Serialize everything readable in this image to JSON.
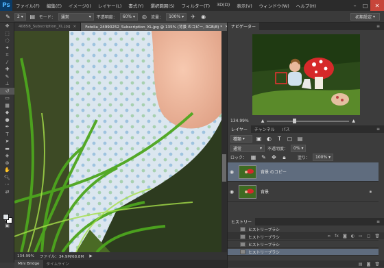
{
  "app": {
    "logo": "Ps"
  },
  "menu": [
    "ファイル(F)",
    "編集(E)",
    "イメージ(I)",
    "レイヤー(L)",
    "書式(Y)",
    "選択範囲(S)",
    "フィルター(T)",
    "3D(D)",
    "表示(V)",
    "ウィンドウ(W)",
    "ヘルプ(H)"
  ],
  "options": {
    "brush_size": "2",
    "mode_label": "モード：",
    "mode_value": "通常",
    "opacity_label": "不透明度：",
    "opacity_value": "60%",
    "flow_label": "流量：",
    "flow_value": "100%",
    "workspace": "初期設定"
  },
  "tabs": [
    {
      "label": "40858_Subscription_XL.jpg",
      "active": false
    },
    {
      "label": "Fotolia_24990252_Subscription_XL.jpg @ 135% (背景 のコピー, RGB/8) *",
      "active": true
    }
  ],
  "status": {
    "zoom": "134.99%",
    "file": "ファイル：34.9M/68.8M"
  },
  "bottom_tabs": [
    "Mini Bridge",
    "タイムライン"
  ],
  "navigator": {
    "title": "ナビゲーター",
    "zoom": "134.99%"
  },
  "layers_panel": {
    "tabs": [
      "レイヤー",
      "チャンネル",
      "パス"
    ],
    "kind_label": "種類",
    "blend_mode": "通常",
    "opacity_label": "不透明度：",
    "opacity_value": "0%",
    "lock_label": "ロック：",
    "fill_label": "塗り：",
    "fill_value": "100%",
    "layers": [
      {
        "name": "背景 のコピー",
        "selected": true
      },
      {
        "name": "背景",
        "selected": false,
        "locked": true
      }
    ]
  },
  "history_panel": {
    "title": "ヒストリー",
    "items": [
      {
        "name": "ヒストリーブラシ",
        "selected": false
      },
      {
        "name": "ヒストリーブラシ",
        "selected": false
      },
      {
        "name": "ヒストリーブラシ",
        "selected": false
      },
      {
        "name": "ヒストリーブラシ",
        "selected": true
      }
    ]
  },
  "colors": {
    "accent_selection": "#5f6c7e",
    "close_button": "#c7453a"
  }
}
